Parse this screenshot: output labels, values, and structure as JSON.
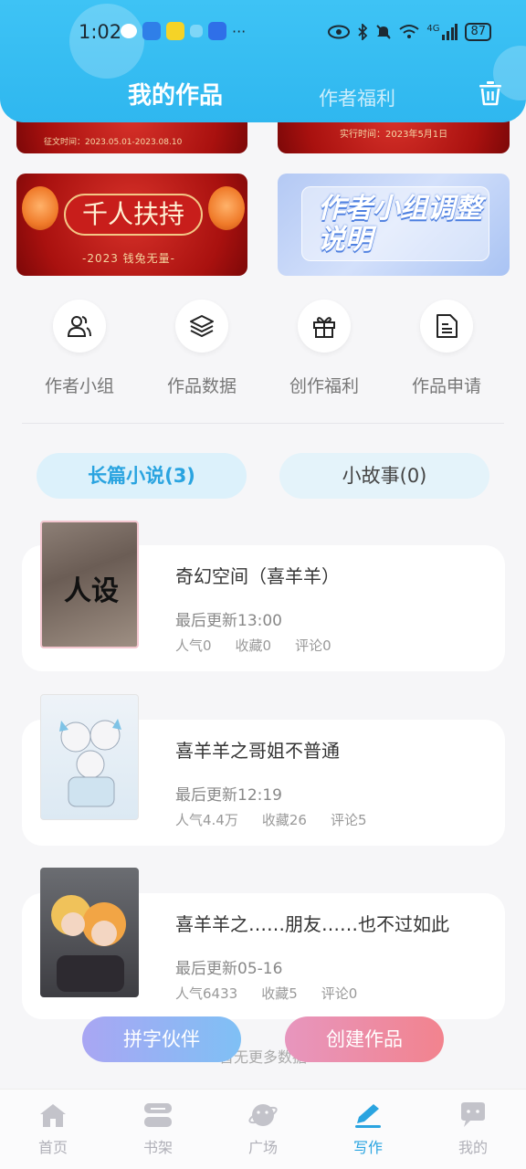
{
  "status_bar": {
    "time": "1:02",
    "network": "4G",
    "battery": "87"
  },
  "header": {
    "tab_active": "我的作品",
    "tab_other": "作者福利"
  },
  "banners": {
    "top_left_text": "征文时间：2023.05.01-2023.08.10",
    "top_right_text": "实行时间：2023年5月1日",
    "left_title": "千人扶持",
    "left_subtitle": "-2023 钱兔无量-",
    "right_title": "作者小组调整说明"
  },
  "shortcuts": [
    {
      "label": "作者小组",
      "icon": "users-icon"
    },
    {
      "label": "作品数据",
      "icon": "layers-icon"
    },
    {
      "label": "创作福利",
      "icon": "gift-icon"
    },
    {
      "label": "作品申请",
      "icon": "document-icon"
    }
  ],
  "categories": {
    "novel": "长篇小说(3)",
    "story": "小故事(0)"
  },
  "works": [
    {
      "title": "奇幻空间（喜羊羊）",
      "update": "最后更新13:00",
      "pop": "人气0",
      "fav": "收藏0",
      "comments": "评论0",
      "cover_text": "人设"
    },
    {
      "title": "喜羊羊之哥姐不普通",
      "update": "最后更新12:19",
      "pop": "人气4.4万",
      "fav": "收藏26",
      "comments": "评论5"
    },
    {
      "title": "喜羊羊之……朋友……也不过如此",
      "update": "最后更新05-16",
      "pop": "人气6433",
      "fav": "收藏5",
      "comments": "评论0"
    }
  ],
  "no_more": "暂无更多数据",
  "buttons": {
    "partner": "拼字伙伴",
    "create": "创建作品"
  },
  "bottom_nav": [
    {
      "label": "首页",
      "icon": "home-icon"
    },
    {
      "label": "书架",
      "icon": "bookshelf-icon"
    },
    {
      "label": "广场",
      "icon": "planet-icon"
    },
    {
      "label": "写作",
      "icon": "pen-icon",
      "active": true
    },
    {
      "label": "我的",
      "icon": "chat-icon"
    }
  ],
  "colors": {
    "accent": "#2aa4e0",
    "header": "#3ec3f5"
  }
}
